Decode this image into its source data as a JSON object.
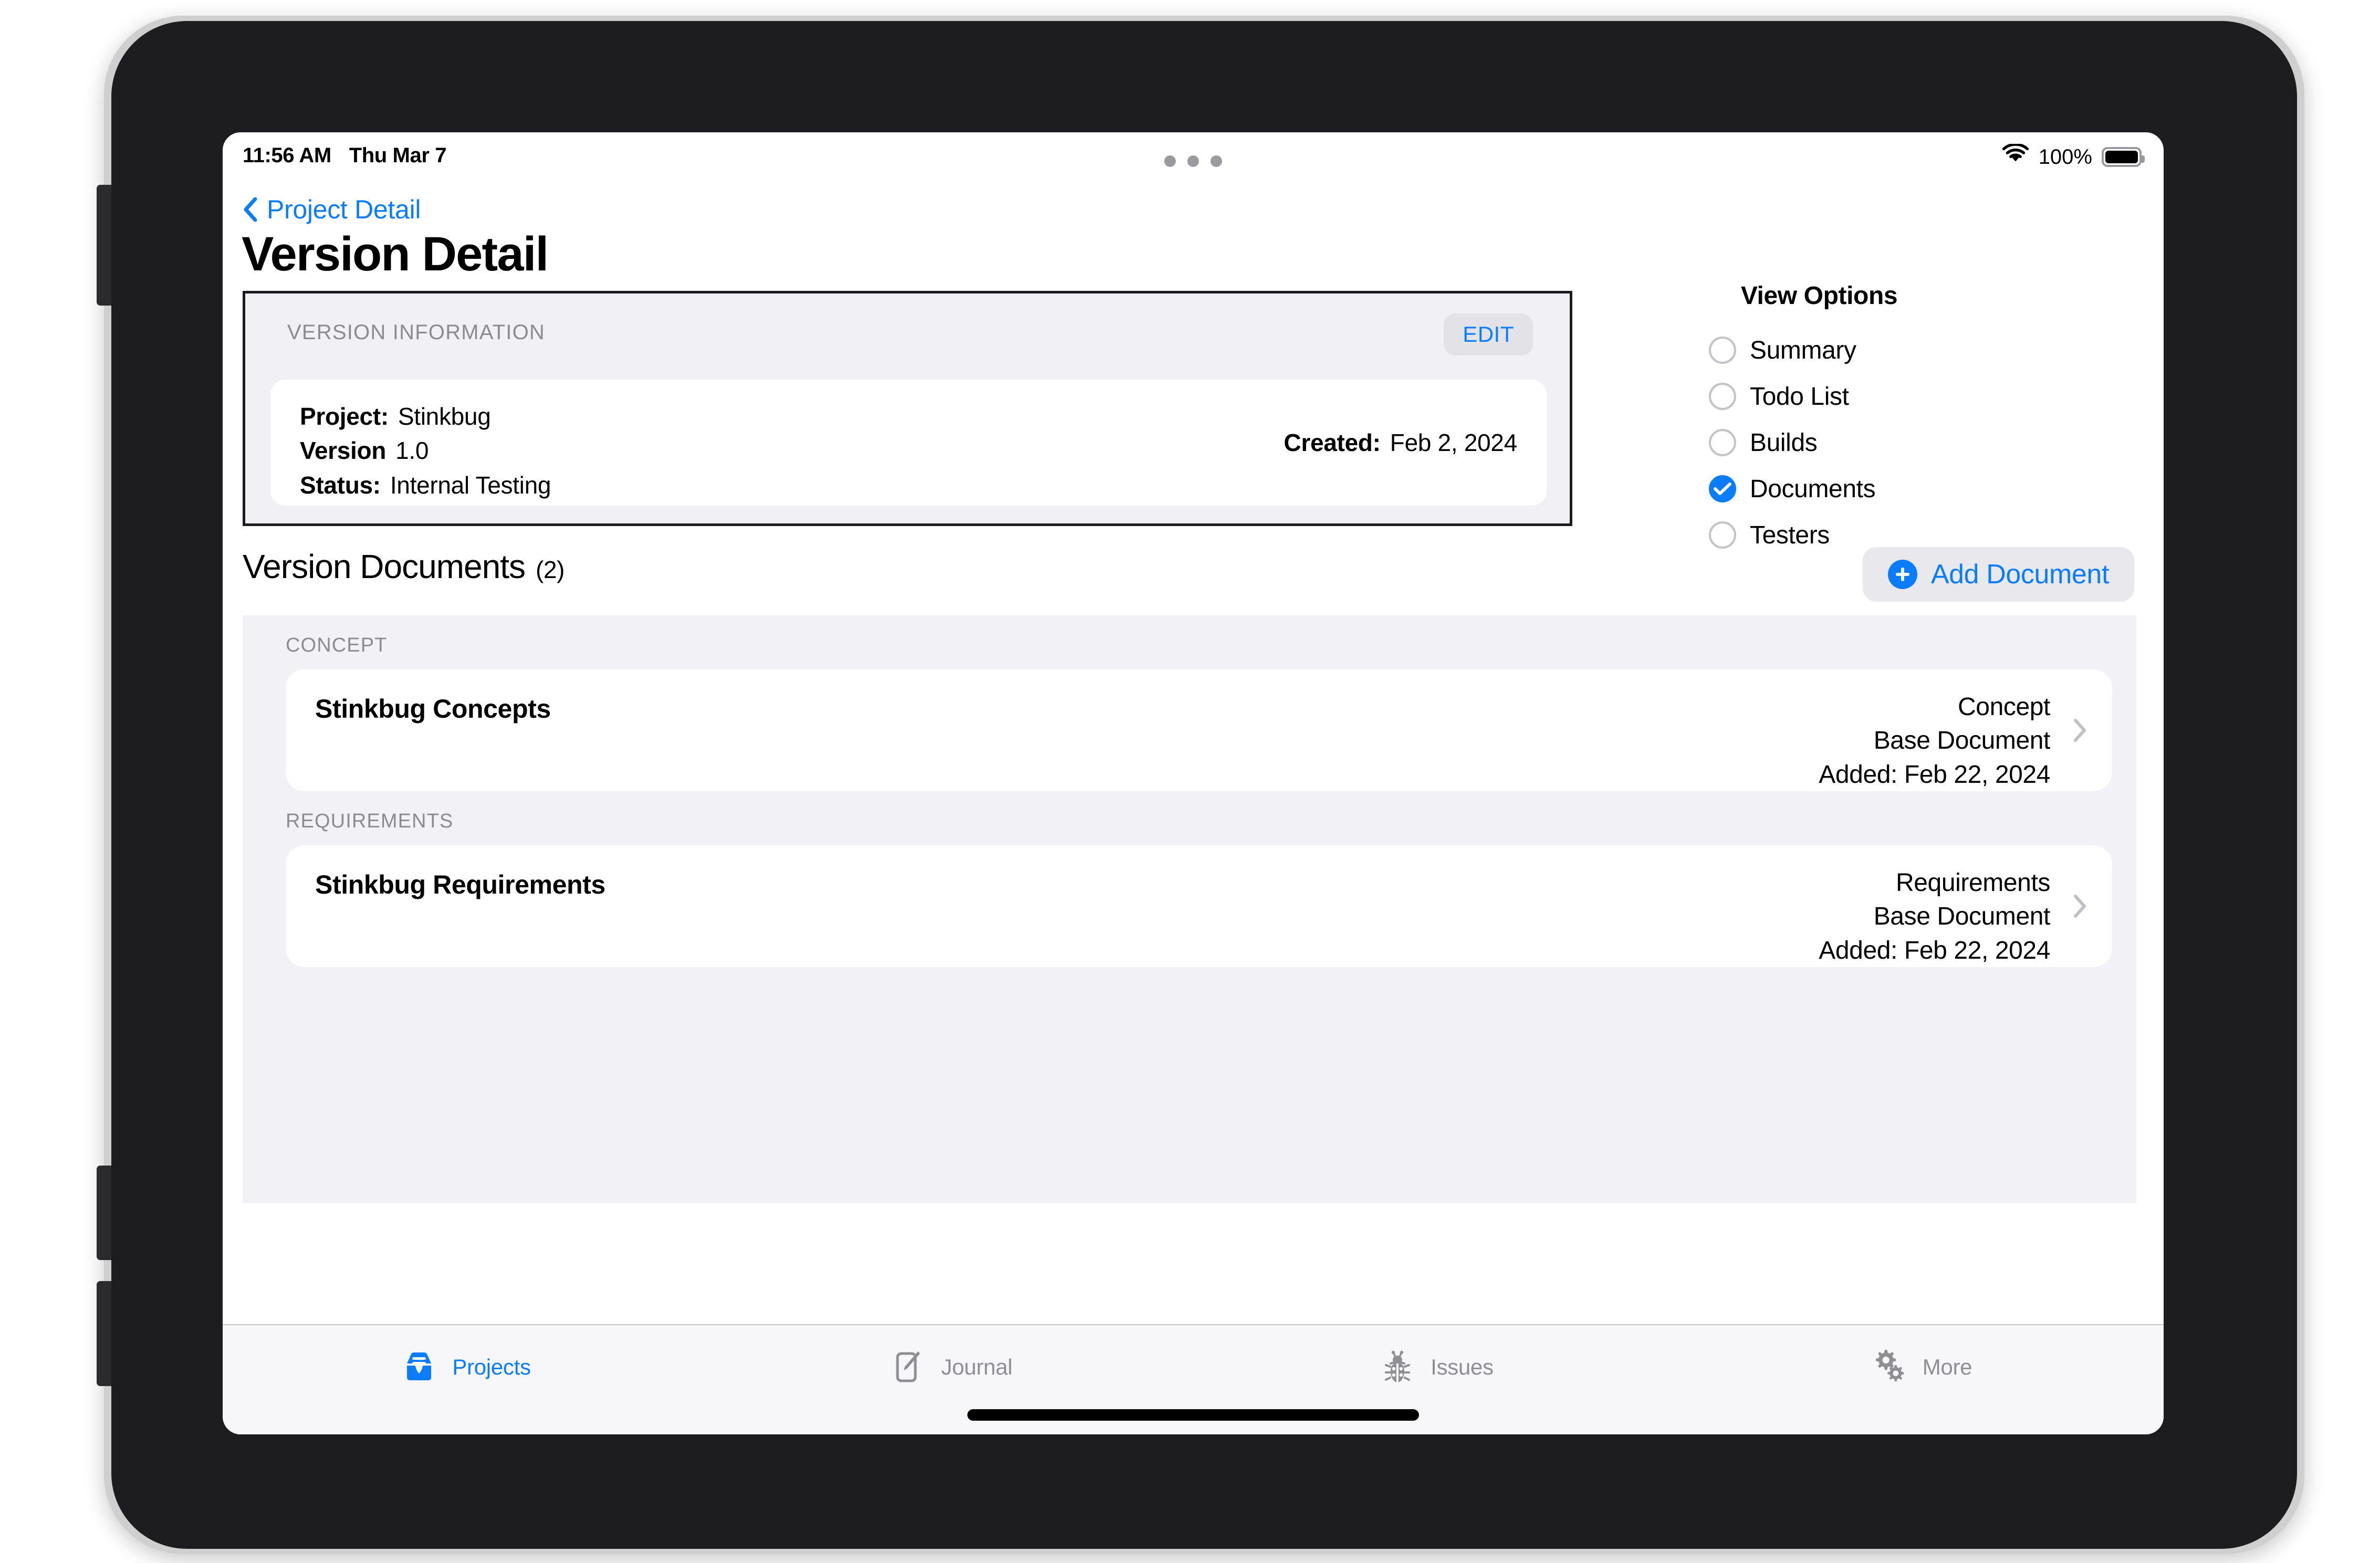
{
  "status_bar": {
    "time": "11:56 AM",
    "date": "Thu Mar 7",
    "battery_percent": "100%"
  },
  "nav": {
    "back_label": "Project Detail",
    "page_title": "Version Detail"
  },
  "version_info": {
    "section_label": "VERSION INFORMATION",
    "edit_label": "EDIT",
    "rows": [
      {
        "key": "Project:",
        "value": "Stinkbug"
      },
      {
        "key": "Version",
        "value": "1.0"
      },
      {
        "key": "Status:",
        "value": "Internal Testing"
      }
    ],
    "created_key": "Created:",
    "created_value": "Feb 2, 2024"
  },
  "view_options": {
    "title": "View Options",
    "items": [
      {
        "label": "Summary",
        "selected": false
      },
      {
        "label": "Todo List",
        "selected": false
      },
      {
        "label": "Builds",
        "selected": false
      },
      {
        "label": "Documents",
        "selected": true
      },
      {
        "label": "Testers",
        "selected": false
      }
    ]
  },
  "documents_section": {
    "title": "Version Documents",
    "count": "(2)",
    "add_button_label": "Add Document",
    "groups": [
      {
        "section_label": "CONCEPT",
        "name": "Stinkbug Concepts",
        "type": "Concept",
        "base": "Base Document",
        "added": "Added: Feb 22, 2024"
      },
      {
        "section_label": "REQUIREMENTS",
        "name": "Stinkbug Requirements",
        "type": "Requirements",
        "base": "Base Document",
        "added": "Added: Feb 22, 2024"
      }
    ]
  },
  "tab_bar": {
    "items": [
      {
        "label": "Projects",
        "icon": "tray-icon",
        "active": true
      },
      {
        "label": "Journal",
        "icon": "note-pencil-icon",
        "active": false
      },
      {
        "label": "Issues",
        "icon": "bug-icon",
        "active": false
      },
      {
        "label": "More",
        "icon": "gears-icon",
        "active": false
      }
    ]
  },
  "colors": {
    "accent": "#0a7cff",
    "section_bg": "#f1f1f6",
    "muted_text": "#8b8b90"
  }
}
